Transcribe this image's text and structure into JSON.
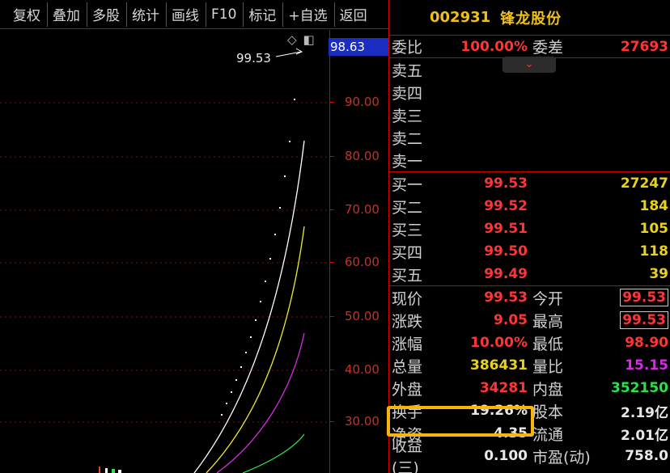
{
  "toolbar": {
    "buttons": [
      "复权",
      "叠加",
      "多股",
      "统计",
      "画线",
      "F10",
      "标记",
      "+自选",
      "返回"
    ]
  },
  "chart": {
    "last_price_label": "99.53",
    "current_axis_value": "98.63",
    "ticks": [
      "90.00",
      "80.00",
      "70.00",
      "60.00",
      "50.00",
      "40.00",
      "30.00"
    ],
    "icons": [
      "diamond-icon",
      "panel-toggle-icon"
    ]
  },
  "quote": {
    "code": "002931",
    "name": "锋龙股份",
    "weibi_label": "委比",
    "weibi_value": "100.00%",
    "weicha_label": "委差",
    "weicha_value": "27693",
    "sell": [
      {
        "label": "卖五",
        "price": "",
        "volume": ""
      },
      {
        "label": "卖四",
        "price": "",
        "volume": ""
      },
      {
        "label": "卖三",
        "price": "",
        "volume": ""
      },
      {
        "label": "卖二",
        "price": "",
        "volume": ""
      },
      {
        "label": "卖一",
        "price": "",
        "volume": ""
      }
    ],
    "buy": [
      {
        "label": "买一",
        "price": "99.53",
        "volume": "27247"
      },
      {
        "label": "买二",
        "price": "99.52",
        "volume": "184"
      },
      {
        "label": "买三",
        "price": "99.51",
        "volume": "105"
      },
      {
        "label": "买四",
        "price": "99.50",
        "volume": "118"
      },
      {
        "label": "买五",
        "price": "99.49",
        "volume": "39"
      }
    ],
    "stats": [
      {
        "l1": "现价",
        "v1": "99.53",
        "c1": "red",
        "l2": "今开",
        "v2": "99.53",
        "c2": "red boxed"
      },
      {
        "l1": "涨跌",
        "v1": "9.05",
        "c1": "red",
        "l2": "最高",
        "v2": "99.53",
        "c2": "red boxed"
      },
      {
        "l1": "涨幅",
        "v1": "10.00%",
        "c1": "red",
        "l2": "最低",
        "v2": "98.90",
        "c2": "red"
      },
      {
        "l1": "总量",
        "v1": "386431",
        "c1": "yellow",
        "l2": "量比",
        "v2": "15.15",
        "c2": "magenta"
      },
      {
        "l1": "外盘",
        "v1": "34281",
        "c1": "red",
        "l2": "内盘",
        "v2": "352150",
        "c2": "green"
      },
      {
        "l1": "换手",
        "v1": "19.26%",
        "c1": "white",
        "l2": "股本",
        "v2": "2.19亿",
        "c2": "white"
      },
      {
        "l1": "净资",
        "v1": "4.35",
        "c1": "white",
        "l2": "流通",
        "v2": "2.01亿",
        "c2": "white"
      },
      {
        "l1": "收益(三)",
        "v1": "0.100",
        "c1": "white",
        "l2": "市盈(动)",
        "v2": "758.0",
        "c2": "white"
      }
    ]
  },
  "colors": {
    "up": "#ff3434",
    "volume": "#e8d21c",
    "down": "#2ce04a",
    "highlight": "#f5b50c"
  }
}
